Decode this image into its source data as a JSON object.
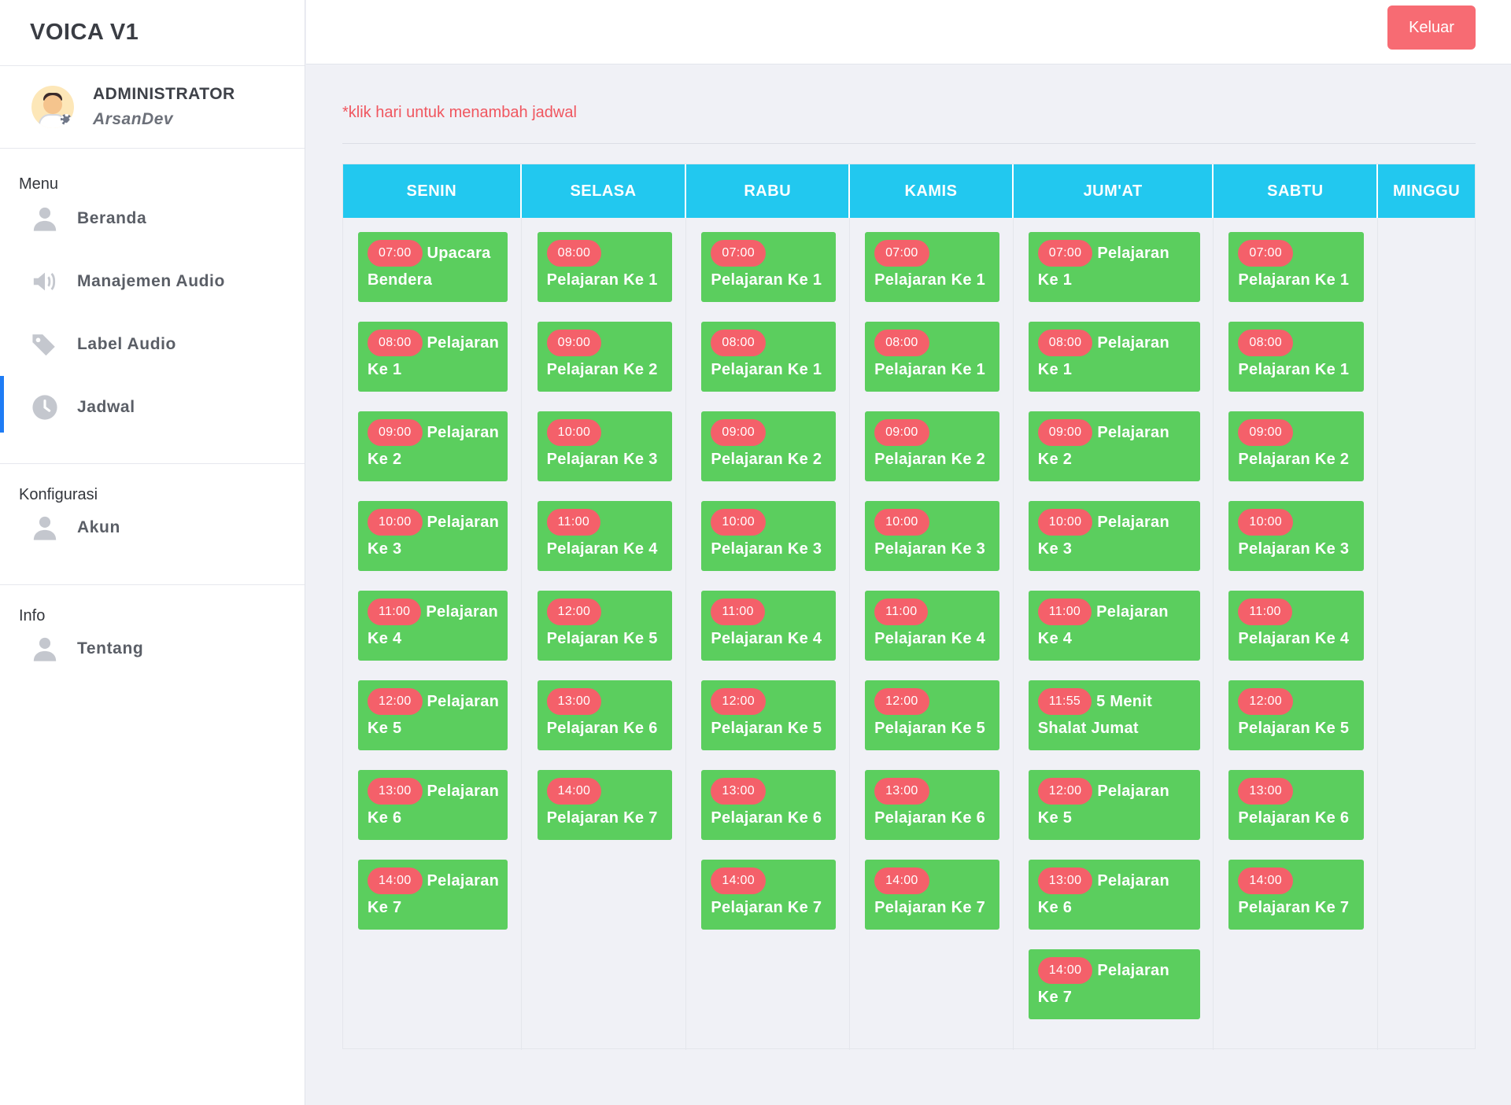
{
  "app": {
    "title": "VOICA V1"
  },
  "profile": {
    "role": "ADMINISTRATOR",
    "user": "ArsanDev"
  },
  "sidebar": {
    "sections": [
      {
        "title": "Menu",
        "items": [
          {
            "label": "Beranda",
            "icon": "user-icon"
          },
          {
            "label": "Manajemen Audio",
            "icon": "volume-icon"
          },
          {
            "label": "Label Audio",
            "icon": "tags-icon"
          },
          {
            "label": "Jadwal",
            "icon": "clock-icon",
            "active": true
          }
        ]
      },
      {
        "title": "Konfigurasi",
        "items": [
          {
            "label": "Akun",
            "icon": "user-icon"
          }
        ]
      },
      {
        "title": "Info",
        "items": [
          {
            "label": "Tentang",
            "icon": "user-icon"
          }
        ]
      }
    ]
  },
  "topbar": {
    "logout_label": "Keluar"
  },
  "main": {
    "hint": "*klik hari untuk menambah jadwal"
  },
  "schedule": {
    "days": [
      {
        "name": "SENIN",
        "items": [
          {
            "time": "07:00",
            "name": "Upacara Bendera"
          },
          {
            "time": "08:00",
            "name": "Pelajaran Ke 1"
          },
          {
            "time": "09:00",
            "name": "Pelajaran Ke 2"
          },
          {
            "time": "10:00",
            "name": "Pelajaran Ke 3"
          },
          {
            "time": "11:00",
            "name": "Pelajaran Ke 4"
          },
          {
            "time": "12:00",
            "name": "Pelajaran Ke 5"
          },
          {
            "time": "13:00",
            "name": "Pelajaran Ke 6"
          },
          {
            "time": "14:00",
            "name": "Pelajaran Ke 7"
          }
        ]
      },
      {
        "name": "SELASA",
        "items": [
          {
            "time": "08:00",
            "name": "Pelajaran Ke 1"
          },
          {
            "time": "09:00",
            "name": "Pelajaran Ke 2"
          },
          {
            "time": "10:00",
            "name": "Pelajaran Ke 3"
          },
          {
            "time": "11:00",
            "name": "Pelajaran Ke 4"
          },
          {
            "time": "12:00",
            "name": "Pelajaran Ke 5"
          },
          {
            "time": "13:00",
            "name": "Pelajaran Ke 6"
          },
          {
            "time": "14:00",
            "name": "Pelajaran Ke 7"
          }
        ]
      },
      {
        "name": "RABU",
        "items": [
          {
            "time": "07:00",
            "name": "Pelajaran Ke 1"
          },
          {
            "time": "08:00",
            "name": "Pelajaran Ke 1"
          },
          {
            "time": "09:00",
            "name": "Pelajaran Ke 2"
          },
          {
            "time": "10:00",
            "name": "Pelajaran Ke 3"
          },
          {
            "time": "11:00",
            "name": "Pelajaran Ke 4"
          },
          {
            "time": "12:00",
            "name": "Pelajaran Ke 5"
          },
          {
            "time": "13:00",
            "name": "Pelajaran Ke 6"
          },
          {
            "time": "14:00",
            "name": "Pelajaran Ke 7"
          }
        ]
      },
      {
        "name": "KAMIS",
        "items": [
          {
            "time": "07:00",
            "name": "Pelajaran Ke 1"
          },
          {
            "time": "08:00",
            "name": "Pelajaran Ke 1"
          },
          {
            "time": "09:00",
            "name": "Pelajaran Ke 2"
          },
          {
            "time": "10:00",
            "name": "Pelajaran Ke 3"
          },
          {
            "time": "11:00",
            "name": "Pelajaran Ke 4"
          },
          {
            "time": "12:00",
            "name": "Pelajaran Ke 5"
          },
          {
            "time": "13:00",
            "name": "Pelajaran Ke 6"
          },
          {
            "time": "14:00",
            "name": "Pelajaran Ke 7"
          }
        ]
      },
      {
        "name": "JUM'AT",
        "items": [
          {
            "time": "07:00",
            "name": "Pelajaran Ke 1"
          },
          {
            "time": "08:00",
            "name": "Pelajaran Ke 1"
          },
          {
            "time": "09:00",
            "name": "Pelajaran Ke 2"
          },
          {
            "time": "10:00",
            "name": "Pelajaran Ke 3"
          },
          {
            "time": "11:00",
            "name": "Pelajaran Ke 4"
          },
          {
            "time": "11:55",
            "name": "5 Menit Shalat Jumat"
          },
          {
            "time": "12:00",
            "name": "Pelajaran Ke 5"
          },
          {
            "time": "13:00",
            "name": "Pelajaran Ke 6"
          },
          {
            "time": "14:00",
            "name": "Pelajaran Ke 7"
          }
        ]
      },
      {
        "name": "SABTU",
        "items": [
          {
            "time": "07:00",
            "name": "Pelajaran Ke 1"
          },
          {
            "time": "08:00",
            "name": "Pelajaran Ke 1"
          },
          {
            "time": "09:00",
            "name": "Pelajaran Ke 2"
          },
          {
            "time": "10:00",
            "name": "Pelajaran Ke 3"
          },
          {
            "time": "11:00",
            "name": "Pelajaran Ke 4"
          },
          {
            "time": "12:00",
            "name": "Pelajaran Ke 5"
          },
          {
            "time": "13:00",
            "name": "Pelajaran Ke 6"
          },
          {
            "time": "14:00",
            "name": "Pelajaran Ke 7"
          }
        ]
      },
      {
        "name": "MINGGU",
        "items": []
      }
    ]
  },
  "colors": {
    "header": "#22c8ef",
    "card": "#5bce5e",
    "badge": "#f4606a",
    "logout": "#f76b73",
    "hint": "#f0565f",
    "active": "#1e7cf5"
  }
}
